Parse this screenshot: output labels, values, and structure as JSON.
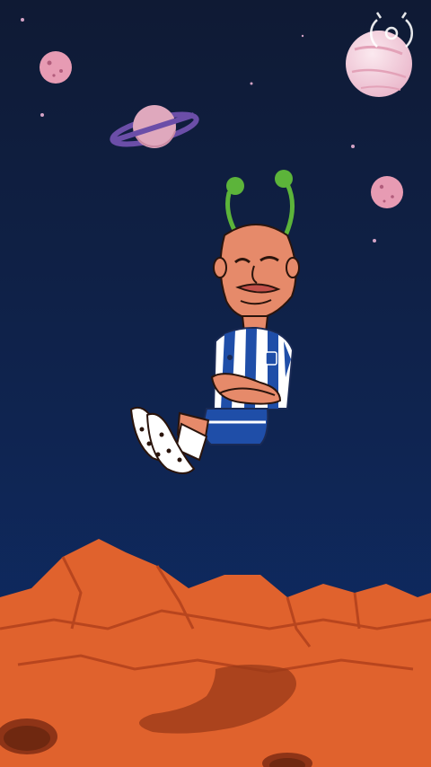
{
  "scene": {
    "colors": {
      "sky_top": "#101d3a",
      "sky_bottom": "#0e2a63",
      "ground": "#e0622d",
      "ground_dark": "#b8451e",
      "ground_shadow": "#8e3417",
      "planet_pink": "#e79bb3",
      "planet_pale": "#f4d8e4",
      "ring": "#6b4ea8",
      "antenna_green": "#5cb43a",
      "skin": "#e68a6a",
      "jersey_blue": "#1f4ea8",
      "jersey_white": "#ffffff",
      "shorts_blue": "#1f4ea8"
    },
    "icons": {
      "watermark": "wreath-logo-icon"
    }
  }
}
